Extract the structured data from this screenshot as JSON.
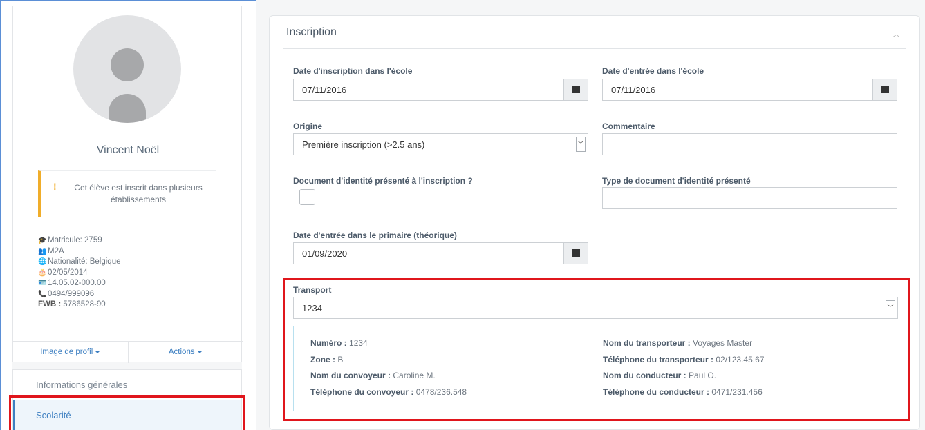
{
  "profile": {
    "name": "Vincent Noël",
    "alert_icon": "!",
    "alert_text": "Cet élève est inscrit dans plusieurs établissements",
    "info": [
      {
        "icon": "graduation-cap-icon",
        "glyph": "🎓",
        "text": "Matricule: 2759"
      },
      {
        "icon": "users-icon",
        "glyph": "👥",
        "text": "M2A"
      },
      {
        "icon": "globe-icon",
        "glyph": "🌐",
        "text": "Nationalité: Belgique"
      },
      {
        "icon": "birthday-cake-icon",
        "glyph": "🎂",
        "text": "02/05/2014"
      },
      {
        "icon": "id-card-icon",
        "glyph": "🪪",
        "text": "14.05.02-000.00"
      },
      {
        "icon": "phone-icon",
        "glyph": "📞",
        "text": "0494/999096"
      }
    ],
    "fwb_label": "FWB :",
    "fwb_value": "5786528-90",
    "image_profile_label": "Image de profil",
    "actions_label": "Actions"
  },
  "nav": {
    "items": [
      "Informations générales",
      "Scolarité"
    ],
    "active": "Scolarité"
  },
  "panel": {
    "title": "Inscription",
    "date_inscription_label": "Date d'inscription dans l'école",
    "date_inscription_value": "07/11/2016",
    "date_entree_label": "Date d'entrée dans l'école",
    "date_entree_value": "07/11/2016",
    "origine_label": "Origine",
    "origine_value": "Première inscription (>2.5 ans)",
    "commentaire_label": "Commentaire",
    "commentaire_value": "",
    "doc_identite_label": "Document d'identité présenté à l'inscription ?",
    "type_doc_label": "Type de document d'identité présenté",
    "type_doc_value": "",
    "date_primaire_label": "Date d'entrée dans le primaire (théorique)",
    "date_primaire_value": "01/09/2020",
    "transport_label": "Transport",
    "transport_value": "1234"
  },
  "transport": {
    "left": [
      {
        "label": "Numéro :",
        "value": "1234"
      },
      {
        "label": "Zone :",
        "value": "B"
      },
      {
        "label": "Nom du convoyeur :",
        "value": "Caroline M."
      },
      {
        "label": "Téléphone du convoyeur :",
        "value": "0478/236.548"
      }
    ],
    "right": [
      {
        "label": "Nom du transporteur :",
        "value": "Voyages Master"
      },
      {
        "label": "Téléphone du transporteur :",
        "value": "02/123.45.67"
      },
      {
        "label": "Nom du conducteur :",
        "value": "Paul O."
      },
      {
        "label": "Téléphone du conducteur :",
        "value": "0471/231.456"
      }
    ]
  },
  "colors": {
    "accent": "#3d7fc1",
    "warning": "#f0ad2a",
    "highlight": "#e0161c"
  }
}
